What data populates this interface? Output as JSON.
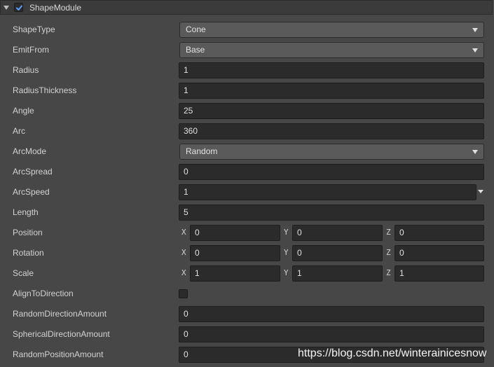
{
  "header": {
    "title": "ShapeModule",
    "enabled": true
  },
  "axis_labels": {
    "x": "X",
    "y": "Y",
    "z": "Z"
  },
  "properties": {
    "shape_type": {
      "label": "ShapeType",
      "value": "Cone"
    },
    "emit_from": {
      "label": "EmitFrom",
      "value": "Base"
    },
    "radius": {
      "label": "Radius",
      "value": "1"
    },
    "radius_thickness": {
      "label": "RadiusThickness",
      "value": "1"
    },
    "angle": {
      "label": "Angle",
      "value": "25"
    },
    "arc": {
      "label": "Arc",
      "value": "360"
    },
    "arc_mode": {
      "label": "ArcMode",
      "value": "Random"
    },
    "arc_spread": {
      "label": "ArcSpread",
      "value": "0"
    },
    "arc_speed": {
      "label": "ArcSpeed",
      "value": "1"
    },
    "length": {
      "label": "Length",
      "value": "5"
    },
    "position": {
      "label": "Position",
      "x": "0",
      "y": "0",
      "z": "0"
    },
    "rotation": {
      "label": "Rotation",
      "x": "0",
      "y": "0",
      "z": "0"
    },
    "scale": {
      "label": "Scale",
      "x": "1",
      "y": "1",
      "z": "1"
    },
    "align_to_direction": {
      "label": "AlignToDirection",
      "checked": false
    },
    "random_direction_amount": {
      "label": "RandomDirectionAmount",
      "value": "0"
    },
    "spherical_direction_amount": {
      "label": "SphericalDirectionAmount",
      "value": "0"
    },
    "random_position_amount": {
      "label": "RandomPositionAmount",
      "value": "0"
    }
  },
  "watermark": "https://blog.csdn.net/winterainicesnow",
  "colors": {
    "panel_bg": "#474747",
    "field_bg": "#2b2b2b",
    "dropdown_bg": "#5a5a5a",
    "header_bg": "#3b3b3b",
    "check_blue": "#5aa0ff"
  }
}
